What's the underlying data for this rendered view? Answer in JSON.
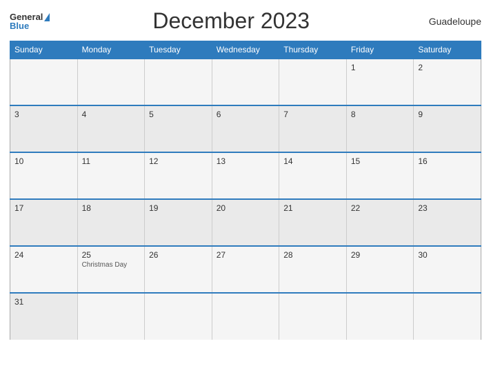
{
  "header": {
    "logo_general": "General",
    "logo_blue": "Blue",
    "title": "December 2023",
    "location": "Guadeloupe"
  },
  "calendar": {
    "weekdays": [
      "Sunday",
      "Monday",
      "Tuesday",
      "Wednesday",
      "Thursday",
      "Friday",
      "Saturday"
    ],
    "rows": [
      [
        {
          "num": "",
          "event": ""
        },
        {
          "num": "",
          "event": ""
        },
        {
          "num": "",
          "event": ""
        },
        {
          "num": "",
          "event": ""
        },
        {
          "num": "1",
          "event": ""
        },
        {
          "num": "2",
          "event": ""
        }
      ],
      [
        {
          "num": "3",
          "event": ""
        },
        {
          "num": "4",
          "event": ""
        },
        {
          "num": "5",
          "event": ""
        },
        {
          "num": "6",
          "event": ""
        },
        {
          "num": "7",
          "event": ""
        },
        {
          "num": "8",
          "event": ""
        },
        {
          "num": "9",
          "event": ""
        }
      ],
      [
        {
          "num": "10",
          "event": ""
        },
        {
          "num": "11",
          "event": ""
        },
        {
          "num": "12",
          "event": ""
        },
        {
          "num": "13",
          "event": ""
        },
        {
          "num": "14",
          "event": ""
        },
        {
          "num": "15",
          "event": ""
        },
        {
          "num": "16",
          "event": ""
        }
      ],
      [
        {
          "num": "17",
          "event": ""
        },
        {
          "num": "18",
          "event": ""
        },
        {
          "num": "19",
          "event": ""
        },
        {
          "num": "20",
          "event": ""
        },
        {
          "num": "21",
          "event": ""
        },
        {
          "num": "22",
          "event": ""
        },
        {
          "num": "23",
          "event": ""
        }
      ],
      [
        {
          "num": "24",
          "event": ""
        },
        {
          "num": "25",
          "event": "Christmas Day"
        },
        {
          "num": "26",
          "event": ""
        },
        {
          "num": "27",
          "event": ""
        },
        {
          "num": "28",
          "event": ""
        },
        {
          "num": "29",
          "event": ""
        },
        {
          "num": "30",
          "event": ""
        }
      ],
      [
        {
          "num": "31",
          "event": ""
        },
        {
          "num": "",
          "event": ""
        },
        {
          "num": "",
          "event": ""
        },
        {
          "num": "",
          "event": ""
        },
        {
          "num": "",
          "event": ""
        },
        {
          "num": "",
          "event": ""
        },
        {
          "num": "",
          "event": ""
        }
      ]
    ]
  }
}
